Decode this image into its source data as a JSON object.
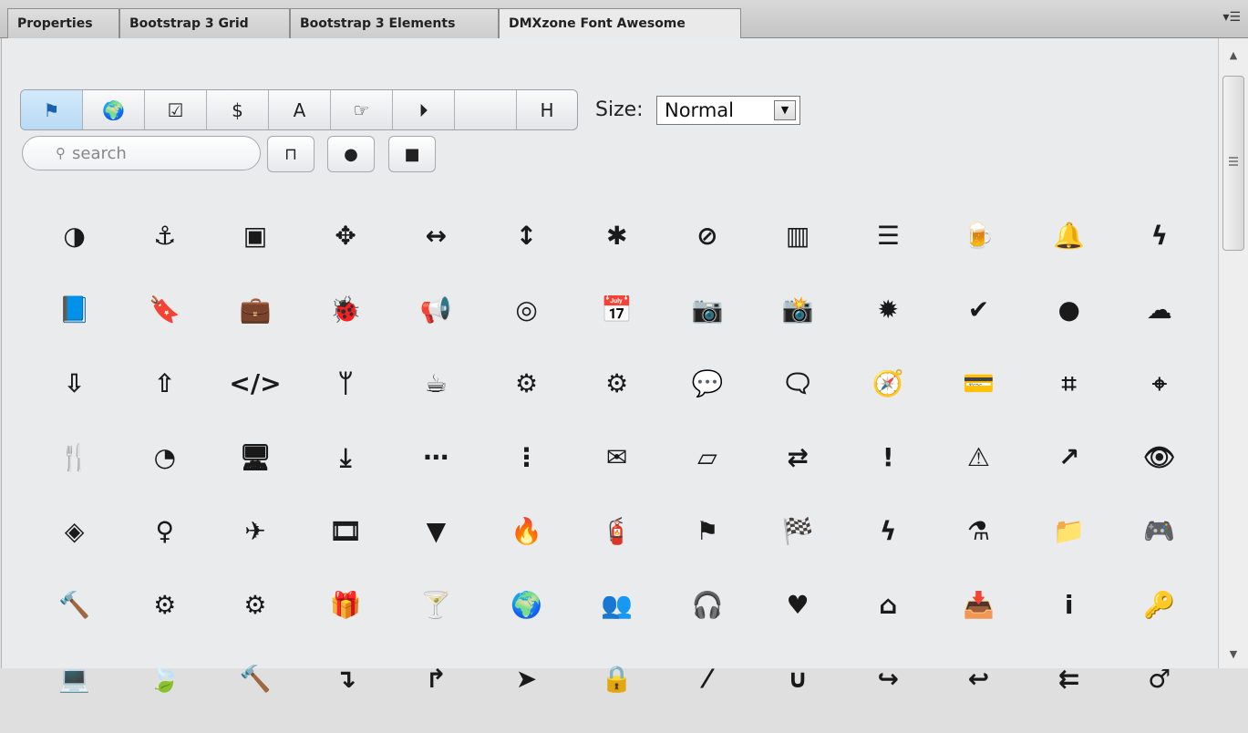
{
  "tabs": [
    {
      "label": "Properties",
      "active": false
    },
    {
      "label": "Bootstrap 3 Grid",
      "active": false
    },
    {
      "label": "Bootstrap 3 Elements",
      "active": false
    },
    {
      "label": "DMXzone Font Awesome",
      "active": true
    }
  ],
  "panel_menu_icon": "panel-menu-icon",
  "categories": [
    {
      "icon": "flag-icon",
      "glyph": "⚑",
      "active": true
    },
    {
      "icon": "globe-icon",
      "glyph": "🌍",
      "active": false
    },
    {
      "icon": "checkbox-icon",
      "glyph": "☑",
      "active": false
    },
    {
      "icon": "dollar-icon",
      "glyph": "$",
      "active": false
    },
    {
      "icon": "font-icon",
      "glyph": "A",
      "active": false
    },
    {
      "icon": "hand-pointer-icon",
      "glyph": "☞",
      "active": false
    },
    {
      "icon": "play-circle-icon",
      "glyph": "⏵",
      "active": false
    },
    {
      "icon": "apple-icon",
      "glyph": "",
      "active": false
    },
    {
      "icon": "h-square-icon",
      "glyph": "H",
      "active": false
    }
  ],
  "size": {
    "label": "Size:",
    "value": "Normal"
  },
  "search": {
    "placeholder": "search"
  },
  "styles": [
    {
      "icon": "bookmark-outline-icon",
      "glyph": "⊓"
    },
    {
      "icon": "circle-icon",
      "glyph": "●"
    },
    {
      "icon": "square-icon",
      "glyph": "■"
    }
  ],
  "icons": [
    {
      "name": "adjust-icon",
      "glyph": "◑"
    },
    {
      "name": "anchor-icon",
      "glyph": "⚓"
    },
    {
      "name": "archive-icon",
      "glyph": "▣"
    },
    {
      "name": "arrows-icon",
      "glyph": "✥"
    },
    {
      "name": "arrows-h-icon",
      "glyph": "↔"
    },
    {
      "name": "arrows-v-icon",
      "glyph": "↕"
    },
    {
      "name": "asterisk-icon",
      "glyph": "✱"
    },
    {
      "name": "ban-icon",
      "glyph": "⊘"
    },
    {
      "name": "barcode-icon",
      "glyph": "▥"
    },
    {
      "name": "bars-icon",
      "glyph": "☰"
    },
    {
      "name": "beer-icon",
      "glyph": "🍺"
    },
    {
      "name": "bell-icon",
      "glyph": "🔔"
    },
    {
      "name": "bolt-icon",
      "glyph": "ϟ"
    },
    {
      "name": "book-icon",
      "glyph": "📘"
    },
    {
      "name": "bookmark-icon",
      "glyph": "🔖"
    },
    {
      "name": "briefcase-icon",
      "glyph": "💼"
    },
    {
      "name": "bug-icon",
      "glyph": "🐞"
    },
    {
      "name": "bullhorn-icon",
      "glyph": "📢"
    },
    {
      "name": "bullseye-icon",
      "glyph": "◎"
    },
    {
      "name": "calendar-icon",
      "glyph": "📅"
    },
    {
      "name": "camera-icon",
      "glyph": "📷"
    },
    {
      "name": "camera-retro-icon",
      "glyph": "📸"
    },
    {
      "name": "certificate-icon",
      "glyph": "✹"
    },
    {
      "name": "check-icon",
      "glyph": "✔"
    },
    {
      "name": "circle-icon",
      "glyph": "●"
    },
    {
      "name": "cloud-icon",
      "glyph": "☁"
    },
    {
      "name": "cloud-download-icon",
      "glyph": "⇩"
    },
    {
      "name": "cloud-upload-icon",
      "glyph": "⇧"
    },
    {
      "name": "code-icon",
      "glyph": "</>"
    },
    {
      "name": "code-fork-icon",
      "glyph": "ᛘ"
    },
    {
      "name": "coffee-icon",
      "glyph": "☕"
    },
    {
      "name": "cog-icon",
      "glyph": "⚙"
    },
    {
      "name": "cogs-icon",
      "glyph": "⚙"
    },
    {
      "name": "comment-icon",
      "glyph": "💬"
    },
    {
      "name": "comments-icon",
      "glyph": "🗨"
    },
    {
      "name": "compass-icon",
      "glyph": "🧭"
    },
    {
      "name": "credit-card-icon",
      "glyph": "💳"
    },
    {
      "name": "crop-icon",
      "glyph": "⌗"
    },
    {
      "name": "crosshairs-icon",
      "glyph": "⌖"
    },
    {
      "name": "cutlery-icon",
      "glyph": "🍴"
    },
    {
      "name": "dashboard-icon",
      "glyph": "◔"
    },
    {
      "name": "desktop-icon",
      "glyph": "🖥"
    },
    {
      "name": "download-icon",
      "glyph": "⤓"
    },
    {
      "name": "ellipsis-h-icon",
      "glyph": "⋯"
    },
    {
      "name": "ellipsis-v-icon",
      "glyph": "⋮"
    },
    {
      "name": "envelope-icon",
      "glyph": "✉"
    },
    {
      "name": "eraser-icon",
      "glyph": "▱"
    },
    {
      "name": "exchange-icon",
      "glyph": "⇄"
    },
    {
      "name": "exclamation-icon",
      "glyph": "!"
    },
    {
      "name": "exclamation-triangle-icon",
      "glyph": "⚠"
    },
    {
      "name": "external-link-icon",
      "glyph": "↗"
    },
    {
      "name": "eye-icon",
      "glyph": "👁"
    },
    {
      "name": "eye-slash-icon",
      "glyph": "◈"
    },
    {
      "name": "female-icon",
      "glyph": "♀"
    },
    {
      "name": "fighter-jet-icon",
      "glyph": "✈"
    },
    {
      "name": "film-icon",
      "glyph": "🎞"
    },
    {
      "name": "filter-icon",
      "glyph": "▼"
    },
    {
      "name": "fire-icon",
      "glyph": "🔥"
    },
    {
      "name": "fire-extinguisher-icon",
      "glyph": "🧯"
    },
    {
      "name": "flag-icon",
      "glyph": "⚑"
    },
    {
      "name": "flag-checkered-icon",
      "glyph": "🏁"
    },
    {
      "name": "flash-icon",
      "glyph": "ϟ"
    },
    {
      "name": "flask-icon",
      "glyph": "⚗"
    },
    {
      "name": "folder-icon",
      "glyph": "📁"
    },
    {
      "name": "gamepad-icon",
      "glyph": "🎮"
    },
    {
      "name": "gavel-icon",
      "glyph": "🔨"
    },
    {
      "name": "gear-icon",
      "glyph": "⚙"
    },
    {
      "name": "gears-icon",
      "glyph": "⚙"
    },
    {
      "name": "gift-icon",
      "glyph": "🎁"
    },
    {
      "name": "glass-icon",
      "glyph": "🍸"
    },
    {
      "name": "globe-icon",
      "glyph": "🌍"
    },
    {
      "name": "group-icon",
      "glyph": "👥"
    },
    {
      "name": "headphones-icon",
      "glyph": "🎧"
    },
    {
      "name": "heart-icon",
      "glyph": "♥"
    },
    {
      "name": "home-icon",
      "glyph": "⌂"
    },
    {
      "name": "inbox-icon",
      "glyph": "📥"
    },
    {
      "name": "info-icon",
      "glyph": "i"
    },
    {
      "name": "key-icon",
      "glyph": "🔑"
    },
    {
      "name": "laptop-icon",
      "glyph": "💻"
    },
    {
      "name": "leaf-icon",
      "glyph": "🍃"
    },
    {
      "name": "legal-icon",
      "glyph": "🔨"
    },
    {
      "name": "level-down-icon",
      "glyph": "↴"
    },
    {
      "name": "level-up-icon",
      "glyph": "↱"
    },
    {
      "name": "location-arrow-icon",
      "glyph": "➤"
    },
    {
      "name": "lock-icon",
      "glyph": "🔒"
    },
    {
      "name": "magic-icon",
      "glyph": "⁄"
    },
    {
      "name": "magnet-icon",
      "glyph": "∪"
    },
    {
      "name": "mail-forward-icon",
      "glyph": "↪"
    },
    {
      "name": "mail-reply-icon",
      "glyph": "↩"
    },
    {
      "name": "mail-reply-all-icon",
      "glyph": "⇇"
    },
    {
      "name": "male-icon",
      "glyph": "♂"
    }
  ]
}
